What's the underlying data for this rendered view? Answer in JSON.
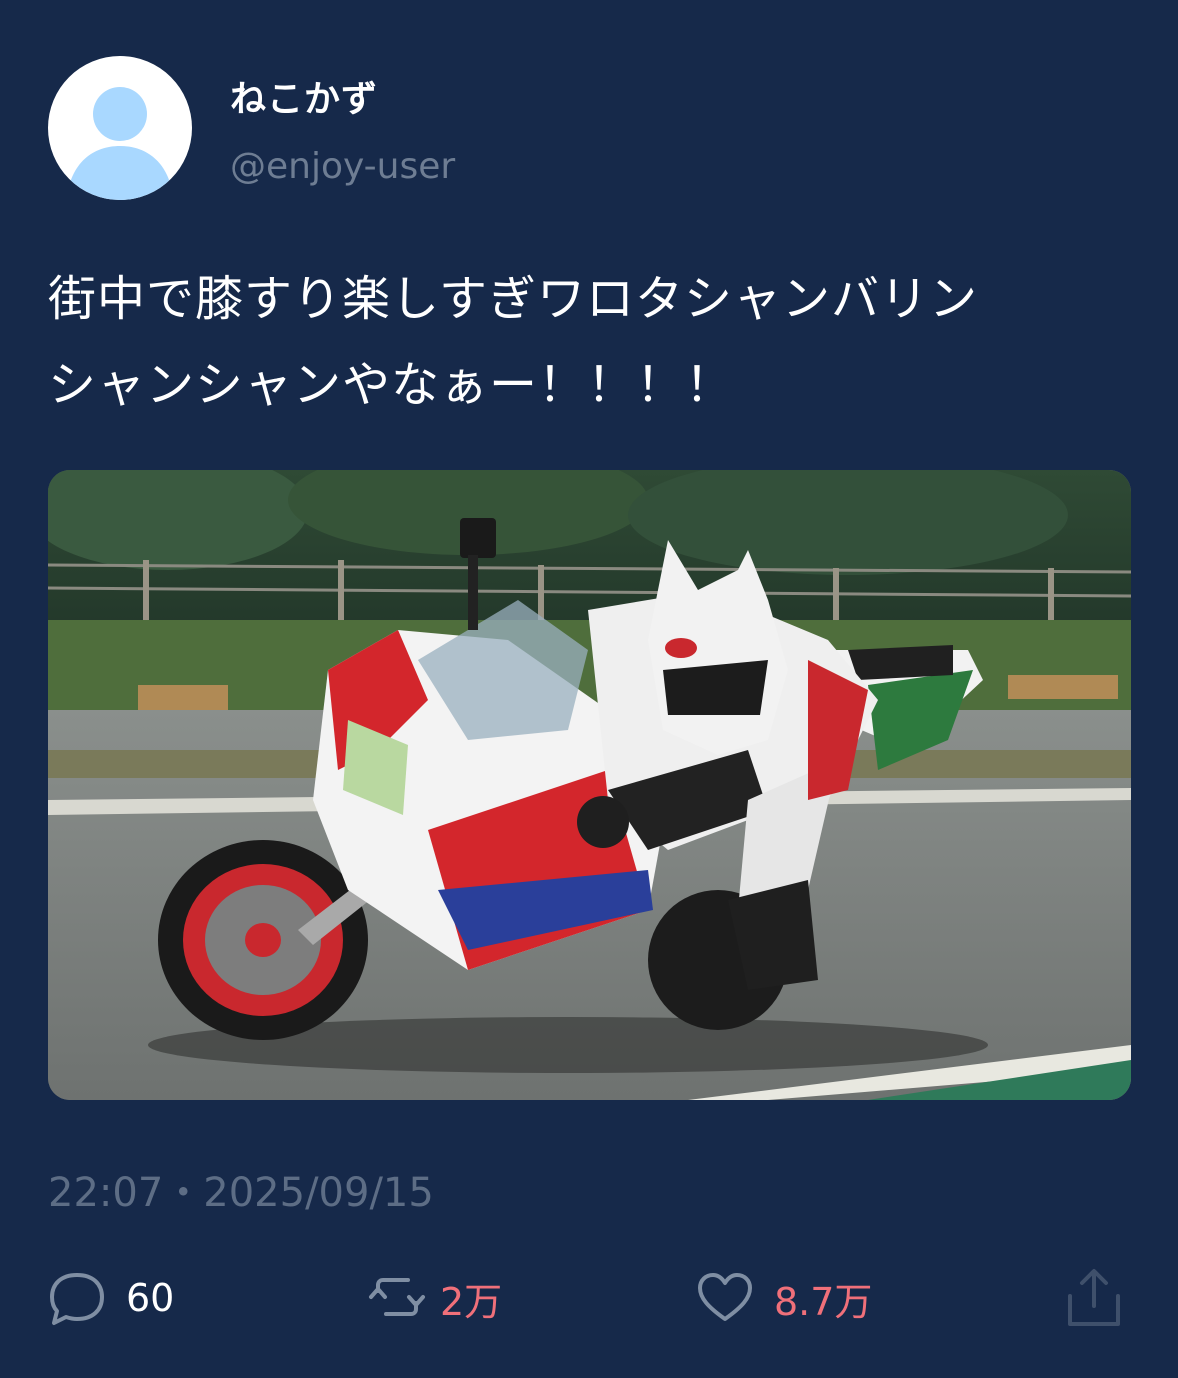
{
  "user": {
    "display_name": "ねこかず",
    "handle": "@enjoy-user"
  },
  "tweet": {
    "text_line1": "街中で膝すり楽しすぎワロタシャンバリン",
    "text_line2": "シャンシャンやなぁー！！！！",
    "timestamp": "22:07・2025/09/15"
  },
  "actions": {
    "reply_count": "60",
    "retweet_count": "2万",
    "like_count": "8.7万"
  },
  "colors": {
    "background": "#16294a",
    "accent": "#f0707a",
    "muted": "#6e7d93",
    "avatar_silhouette": "#a9d8ff"
  },
  "icons": [
    "default-avatar-icon",
    "reply-icon",
    "retweet-icon",
    "like-icon",
    "share-icon"
  ]
}
